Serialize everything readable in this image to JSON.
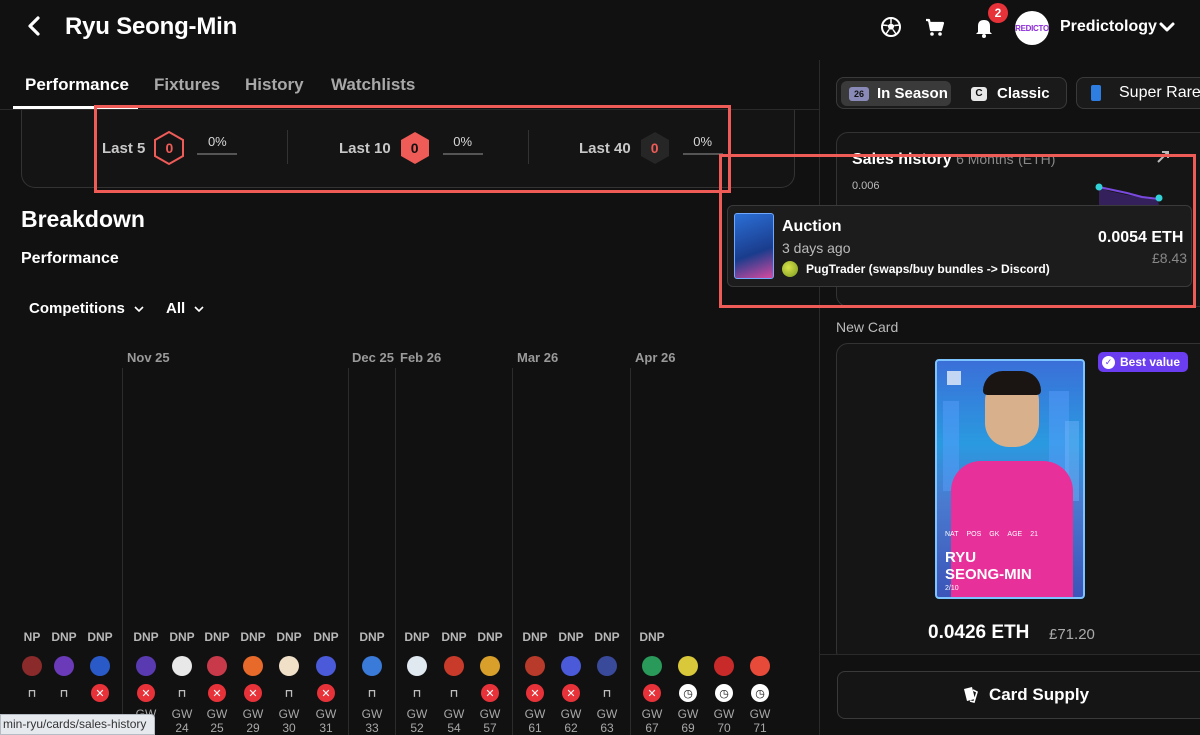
{
  "header": {
    "title": "Ryu Seong-Min",
    "notifications_count": "2",
    "avatar_text": "REDICTO",
    "username": "Predictology"
  },
  "tabs": [
    "Performance",
    "Fixtures",
    "History",
    "Watchlists"
  ],
  "form": [
    {
      "label": "Last 5",
      "score": "0",
      "pct": "0%",
      "style": "outline"
    },
    {
      "label": "Last 10",
      "score": "0",
      "pct": "0%",
      "style": "filled"
    },
    {
      "label": "Last 40",
      "score": "0",
      "pct": "0%",
      "style": "dark"
    }
  ],
  "breakdown": {
    "title": "Breakdown",
    "subtitle": "Performance",
    "filter_competitions": "Competitions",
    "filter_all": "All"
  },
  "timeline": {
    "months": [
      "Nov 25",
      "Dec 25",
      "Feb 26",
      "Mar 26",
      "Apr 26"
    ],
    "games": [
      {
        "dnp": "NP",
        "gw": "",
        "status": "bench",
        "logo": "#8a2a2a"
      },
      {
        "dnp": "DNP",
        "gw": "",
        "status": "bench",
        "logo": "#6a3ab8"
      },
      {
        "dnp": "DNP",
        "gw": "",
        "status": "x",
        "logo": "#2a5ac8"
      },
      {
        "dnp": "DNP",
        "gw": "GW 24",
        "status": "x",
        "logo": "#5a3ab0"
      },
      {
        "dnp": "DNP",
        "gw": "GW 24",
        "status": "bench",
        "logo": "#e8e8e8"
      },
      {
        "dnp": "DNP",
        "gw": "GW 25",
        "status": "x",
        "logo": "#c83a4a"
      },
      {
        "dnp": "DNP",
        "gw": "GW 29",
        "status": "x",
        "logo": "#e86a2a"
      },
      {
        "dnp": "DNP",
        "gw": "GW 30",
        "status": "bench",
        "logo": "#f0e0c8"
      },
      {
        "dnp": "DNP",
        "gw": "GW 31",
        "status": "x",
        "logo": "#4a5ad8"
      },
      {
        "dnp": "DNP",
        "gw": "GW 33",
        "status": "bench",
        "logo": "#3a7ad8"
      },
      {
        "dnp": "DNP",
        "gw": "GW 52",
        "status": "bench",
        "logo": "#e0e8f0"
      },
      {
        "dnp": "DNP",
        "gw": "GW 54",
        "status": "bench",
        "logo": "#c83a2a"
      },
      {
        "dnp": "DNP",
        "gw": "GW 57",
        "status": "x",
        "logo": "#d8a02a"
      },
      {
        "dnp": "DNP",
        "gw": "GW 61",
        "status": "x",
        "logo": "#b83a2a"
      },
      {
        "dnp": "DNP",
        "gw": "GW 62",
        "status": "x",
        "logo": "#4a5ad8"
      },
      {
        "dnp": "DNP",
        "gw": "GW 63",
        "status": "bench",
        "logo": "#3a4a9a"
      },
      {
        "dnp": "DNP",
        "gw": "GW 67",
        "status": "x",
        "logo": "#2a9a5a"
      },
      {
        "dnp": "",
        "gw": "GW 69",
        "status": "clock",
        "logo": "#d8c83a"
      },
      {
        "dnp": "",
        "gw": "GW 70",
        "status": "clock",
        "logo": "#c82a2a"
      },
      {
        "dnp": "",
        "gw": "GW 71",
        "status": "clock",
        "logo": "#e84a3a"
      }
    ]
  },
  "status_url": "min-ryu/cards/sales-history",
  "right": {
    "season_in": "In Season",
    "season_badge": "26",
    "season_classic": "Classic",
    "classic_badge": "C",
    "rarity": "Super Rare",
    "sales_title": "Sales history",
    "sales_period": "6 Months",
    "sales_unit": "(ETH)",
    "sales_axis_value": "0.006",
    "tooltip": {
      "type": "Auction",
      "time": "3 days ago",
      "user": "PugTrader (swaps/buy bundles -> Discord)",
      "eth": "0.0054 ETH",
      "fiat": "£8.43"
    },
    "new_card_label": "New Card",
    "best_value": "Best value",
    "card": {
      "first_name": "RYU",
      "last_name": "SEONG-MIN",
      "serial": "2/10",
      "pos": "GK",
      "age": "21",
      "nat_label": "NAT",
      "pos_label": "POS",
      "age_label": "AGE"
    },
    "price_eth": "0.0426 ETH",
    "price_fiat": "£71.20",
    "supply_button": "Card Supply"
  }
}
